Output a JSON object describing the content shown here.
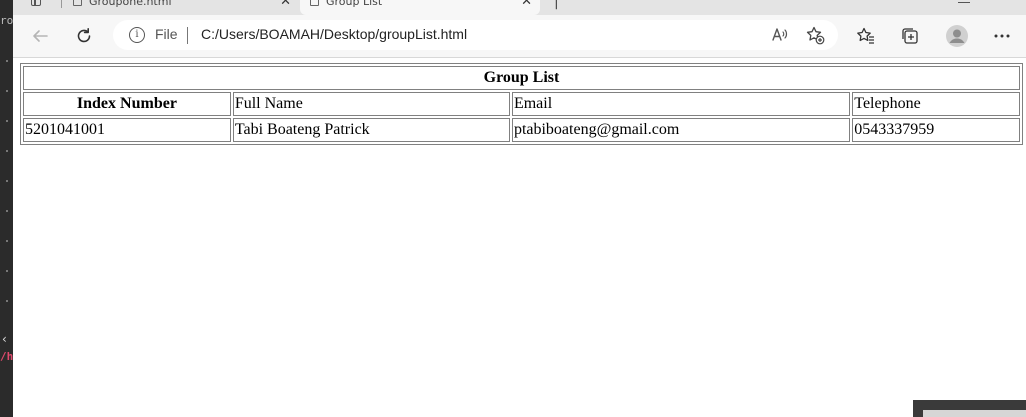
{
  "browser": {
    "tabs": [
      {
        "title": "Groupone.html",
        "active": false
      },
      {
        "title": "Group List",
        "active": true
      }
    ],
    "address": {
      "scheme_label": "File",
      "url": "C:/Users/BOAMAH/Desktop/groupList.html"
    },
    "icons": {
      "back": "arrow-left-icon",
      "refresh": "refresh-icon",
      "info": "info-icon",
      "read_aloud": "read-aloud-icon",
      "add_favorite": "star-plus-icon",
      "favorites": "favorites-icon",
      "collections": "collections-icon",
      "profile": "profile-avatar-icon",
      "menu": "more-icon"
    }
  },
  "editor_fragment": {
    "top_text": "ro",
    "bottom_text": "/h"
  },
  "page": {
    "table": {
      "caption": "Group List",
      "headers": [
        "Index Number",
        "Full Name",
        "Email",
        "Telephone"
      ],
      "rows": [
        [
          "5201041001",
          "Tabi Boateng Patrick",
          "ptabiboateng@gmail.com",
          "0543337959"
        ]
      ]
    }
  }
}
